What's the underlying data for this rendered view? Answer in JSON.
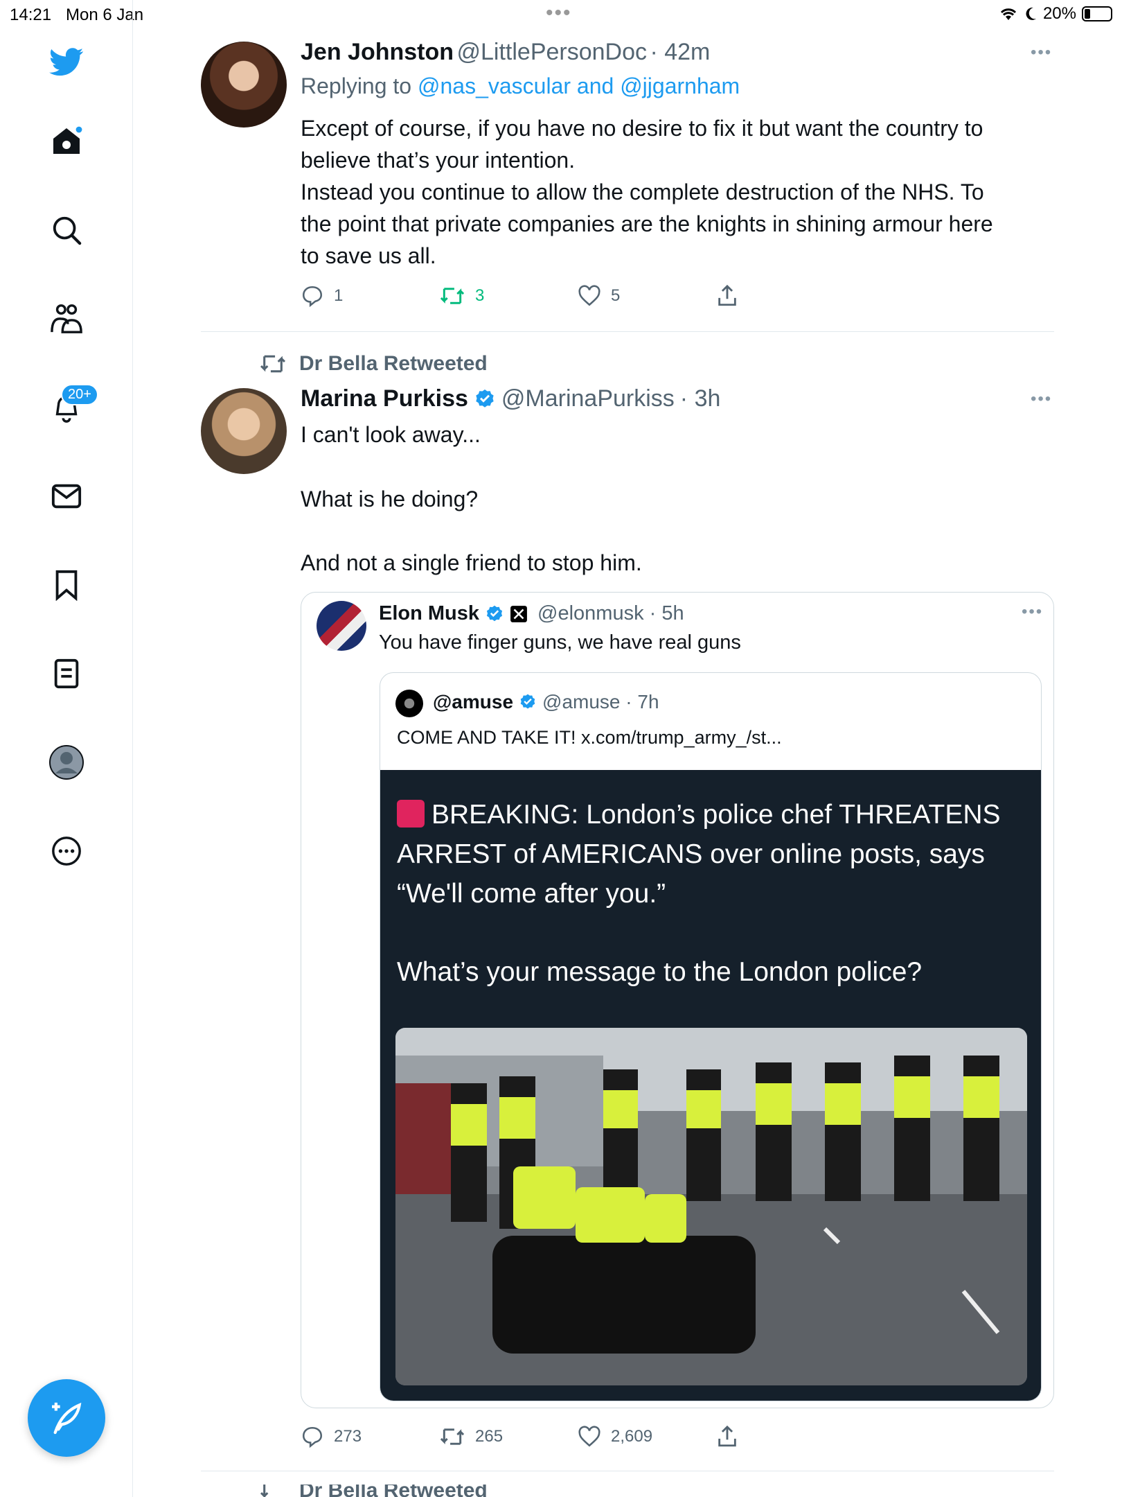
{
  "status_bar": {
    "time": "14:21",
    "date": "Mon 6 Jan",
    "battery": "20%"
  },
  "sidebar": {
    "notification_badge": "20+",
    "icons": [
      "twitter-logo-icon",
      "home-icon",
      "search-icon",
      "communities-icon",
      "notifications-icon",
      "messages-icon",
      "bookmarks-icon",
      "lists-icon",
      "profile-icon",
      "more-icon"
    ]
  },
  "tweets": [
    {
      "name": "Jen Johnston",
      "handle": "@LittlePersonDoc",
      "time": "· 42m",
      "replying_prefix": "Replying to ",
      "replying_to": "@nas_vascular and @jjgarnham",
      "lines": [
        "Except of course, if you have no desire to fix it but want the country to",
        "believe that’s your intention.",
        "Instead you continue to allow the complete destruction of the NHS. To",
        "the point that private companies are the knights in shining armour here",
        "to save us all."
      ],
      "replies": "1",
      "retweets": "3",
      "likes": "5"
    },
    {
      "retweeted_by": "Dr Bella Retweeted",
      "name": "Marina Purkiss",
      "handle": "@MarinaPurkiss",
      "time": "· 3h",
      "line1": "I can't look away...",
      "line2": "What is he doing?",
      "line3": "And not a single friend to stop him.",
      "quoted": {
        "name": "Elon Musk",
        "handle": "@elonmusk · 5h",
        "text": "You have finger guns, we have real guns",
        "inner": {
          "name": "@amuse",
          "handle": "@amuse · 7h",
          "text": "COME AND TAKE IT! x.com/trump_army_/st...",
          "headline_lines": [
            "BREAKING: London’s police chef THREATENS",
            "ARREST of AMERICANS over online posts, says",
            "“We'll come after you.”"
          ],
          "question": "What’s your message to the London police?"
        }
      },
      "replies": "273",
      "retweets": "265",
      "likes": "2,609"
    }
  ],
  "next_retweeted_by": "Dr Bella Retweeted",
  "colors": {
    "accent": "#1d9bf0",
    "retweet_green": "#00ba7c",
    "muted": "#536471",
    "dark_card": "#15202b"
  }
}
